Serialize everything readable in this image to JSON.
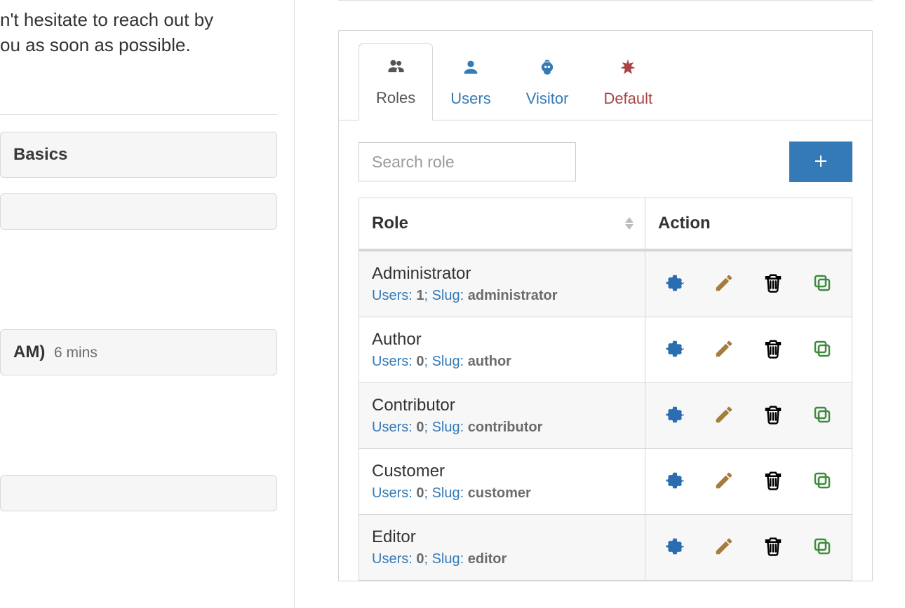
{
  "left": {
    "intro_line1": "n't hesitate to reach out by",
    "intro_line2": "ou as soon as possible.",
    "basics_label": "Basics",
    "time_label": "AM)",
    "time_meta": "6 mins"
  },
  "tabs": [
    {
      "label": "Roles",
      "active": true,
      "style": "active"
    },
    {
      "label": "Users",
      "active": false,
      "style": "inactive"
    },
    {
      "label": "Visitor",
      "active": false,
      "style": "inactive"
    },
    {
      "label": "Default",
      "active": false,
      "style": "default"
    }
  ],
  "search": {
    "placeholder": "Search role"
  },
  "table": {
    "headers": {
      "role": "Role",
      "action": "Action"
    },
    "meta_labels": {
      "users": "Users:",
      "slug": "Slug:"
    },
    "rows": [
      {
        "name": "Administrator",
        "users": "1",
        "slug": "administrator",
        "trash_disabled": true
      },
      {
        "name": "Author",
        "users": "0",
        "slug": "author",
        "trash_disabled": false
      },
      {
        "name": "Contributor",
        "users": "0",
        "slug": "contributor",
        "trash_disabled": false
      },
      {
        "name": "Customer",
        "users": "0",
        "slug": "customer",
        "trash_disabled": false
      },
      {
        "name": "Editor",
        "users": "0",
        "slug": "editor",
        "trash_disabled": false
      }
    ]
  }
}
